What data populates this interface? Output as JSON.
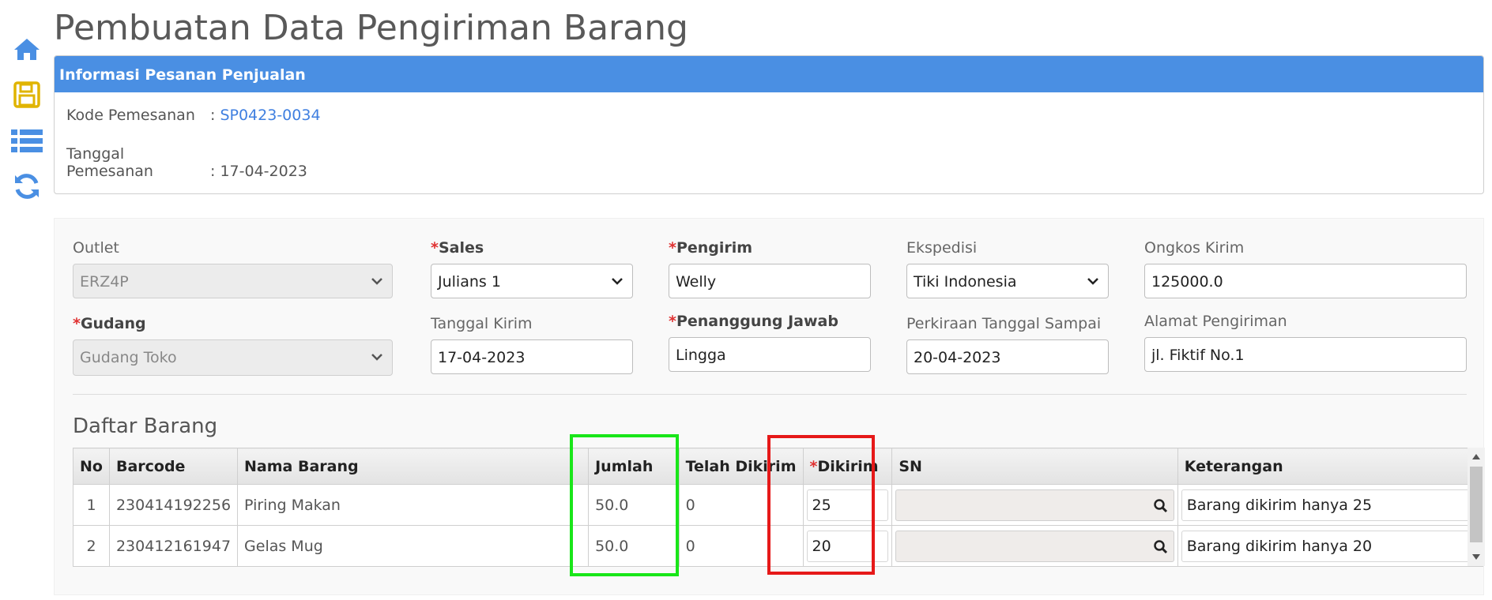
{
  "page": {
    "title": "Pembuatan Data Pengiriman Barang"
  },
  "sidebar": {
    "icons": [
      "home-icon",
      "save-icon",
      "list-icon",
      "refresh-icon"
    ]
  },
  "info": {
    "header": "Informasi Pesanan Penjualan",
    "kode_label": "Kode Pemesanan",
    "kode_value": "SP0423-0034",
    "tanggal_label": "Tanggal Pemesanan",
    "tanggal_value": "17-04-2023",
    "separator": ":"
  },
  "form": {
    "outlet_label": "Outlet",
    "outlet_value": "ERZ4P",
    "sales_label": "Sales",
    "sales_value": "Julians 1",
    "pengirim_label": "Pengirim",
    "pengirim_value": "Welly",
    "ekspedisi_label": "Ekspedisi",
    "ekspedisi_value": "Tiki Indonesia",
    "ongkos_label": "Ongkos Kirim",
    "ongkos_value": "125000.0",
    "gudang_label": "Gudang",
    "gudang_value": "Gudang Toko",
    "tanggal_kirim_label": "Tanggal Kirim",
    "tanggal_kirim_value": "17-04-2023",
    "penanggung_label": "Penanggung Jawab",
    "penanggung_value": "Lingga",
    "perkiraan_label": "Perkiraan Tanggal Sampai",
    "perkiraan_value": "20-04-2023",
    "alamat_label": "Alamat Pengiriman",
    "alamat_value": "jl. Fiktif No.1",
    "required_mark": "*"
  },
  "list": {
    "title": "Daftar Barang",
    "columns": [
      "No",
      "Barcode",
      "Nama Barang",
      "Jumlah",
      "Telah Dikirim",
      "Dikirim",
      "SN",
      "Keterangan"
    ],
    "rows": [
      {
        "no": "1",
        "barcode": "230414192256",
        "nama": "Piring Makan",
        "jumlah": "50.0",
        "telah": "0",
        "dikirim": "25",
        "sn": "",
        "keterangan": "Barang dikirim hanya 25"
      },
      {
        "no": "2",
        "barcode": "230412161947",
        "nama": "Gelas Mug",
        "jumlah": "50.0",
        "telah": "0",
        "dikirim": "20",
        "sn": "",
        "keterangan": "Barang dikirim hanya 20"
      }
    ]
  },
  "colors": {
    "accent": "#4a8fe3",
    "save_icon": "#e0b400",
    "highlight_green": "#19e619",
    "highlight_red": "#e61919"
  }
}
